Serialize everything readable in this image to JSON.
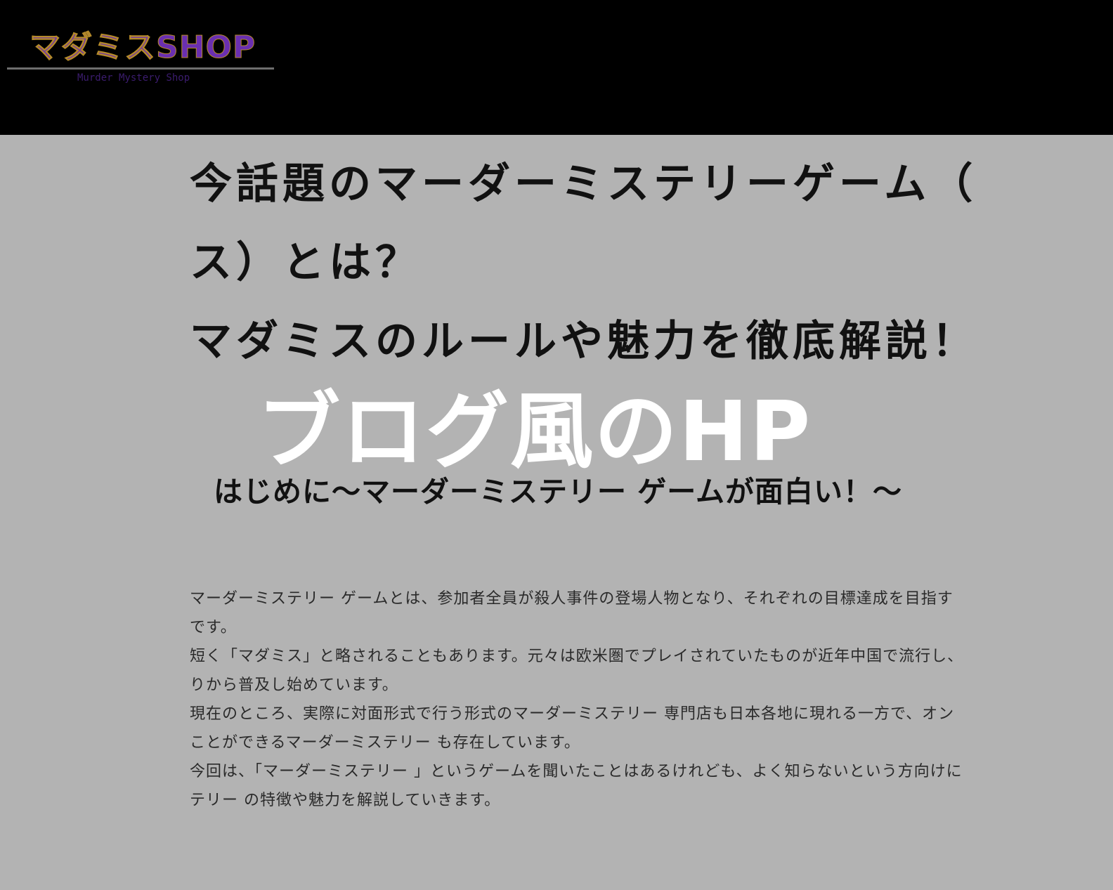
{
  "header": {
    "logo_text": "マダミスSHOP",
    "logo_subtitle": "Murder  Mystery Shop"
  },
  "article": {
    "title_lines": [
      "今話題のマーダーミステリーゲーム（",
      "ス）とは？",
      "マダミスのルールや魅力を徹底解説！"
    ],
    "overlay_caption": "ブログ風のHP",
    "subheading": "はじめに〜マーダーミステリー ゲームが面白い！〜",
    "paragraph_lines": [
      "マーダーミステリー ゲームとは、参加者全員が殺人事件の登場人物となり、それぞれの目標達成を目指す",
      "です。",
      "短く「マダミス」と略されることもあります。元々は欧米圏でプレイされていたものが近年中国で流行し、",
      "りから普及し始めています。",
      "現在のところ、実際に対面形式で行う形式のマーダーミステリー 専門店も日本各地に現れる一方で、オン",
      "ことができるマーダーミステリー も存在しています。",
      "今回は、「マーダーミステリー 」というゲームを聞いたことはあるけれども、よく知らないという方向けに",
      "テリー の特徴や魅力を解説していきます。"
    ]
  },
  "colors": {
    "header_bg": "#000000",
    "page_bg": "#b3b3b3",
    "logo_purple": "#6a2fb0",
    "overlay_text": "#ffffff"
  }
}
